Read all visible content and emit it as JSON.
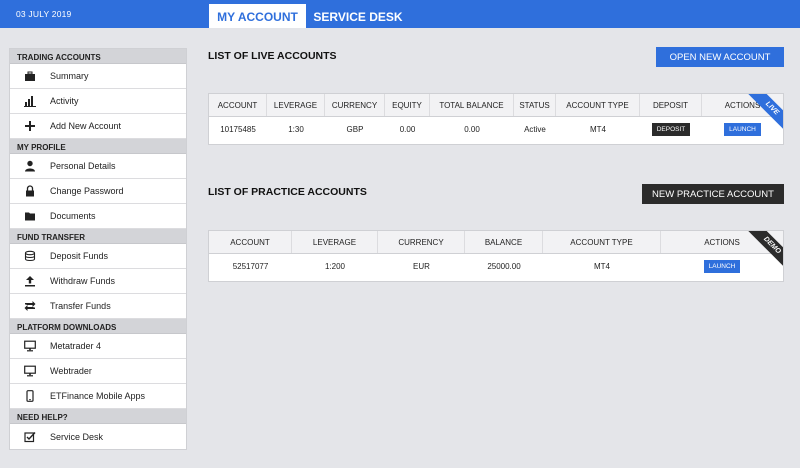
{
  "header": {
    "date": "03 JULY 2019",
    "tabs": [
      {
        "label": "MY ACCOUNT",
        "active": true
      },
      {
        "label": "SERVICE DESK",
        "active": false
      }
    ]
  },
  "sidebar": {
    "sections": [
      {
        "title": "TRADING ACCOUNTS",
        "items": [
          {
            "label": "Summary",
            "icon": "briefcase-icon"
          },
          {
            "label": "Activity",
            "icon": "bar-chart-icon"
          },
          {
            "label": "Add New Account",
            "icon": "plus-icon"
          }
        ]
      },
      {
        "title": "MY PROFILE",
        "items": [
          {
            "label": "Personal Details",
            "icon": "user-icon"
          },
          {
            "label": "Change Password",
            "icon": "lock-icon"
          },
          {
            "label": "Documents",
            "icon": "folder-icon"
          }
        ]
      },
      {
        "title": "FUND TRANSFER",
        "items": [
          {
            "label": "Deposit Funds",
            "icon": "deposit-icon"
          },
          {
            "label": "Withdraw Funds",
            "icon": "upload-icon"
          },
          {
            "label": "Transfer Funds",
            "icon": "transfer-icon"
          }
        ]
      },
      {
        "title": "PLATFORM DOWNLOADS",
        "items": [
          {
            "label": "Metatrader 4",
            "icon": "monitor-icon"
          },
          {
            "label": "Webtrader",
            "icon": "monitor-icon"
          },
          {
            "label": "ETFinance Mobile Apps",
            "icon": "mobile-icon"
          }
        ]
      },
      {
        "title": "NEED HELP?",
        "items": [
          {
            "label": "Service Desk",
            "icon": "checkbox-icon"
          }
        ]
      }
    ]
  },
  "live": {
    "title": "LIST OF LIVE ACCOUNTS",
    "button": "OPEN NEW ACCOUNT",
    "ribbon": "LIVE",
    "columns": [
      "ACCOUNT",
      "LEVERAGE",
      "CURRENCY",
      "EQUITY",
      "TOTAL BALANCE",
      "STATUS",
      "ACCOUNT TYPE",
      "DEPOSIT",
      "ACTIONS"
    ],
    "rows": [
      {
        "account": "10175485",
        "leverage": "1:30",
        "currency": "GBP",
        "equity": "0.00",
        "total_balance": "0.00",
        "status": "Active",
        "account_type": "MT4",
        "deposit": "DEPOSIT",
        "action": "LAUNCH"
      }
    ]
  },
  "practice": {
    "title": "LIST OF PRACTICE ACCOUNTS",
    "button": "NEW PRACTICE ACCOUNT",
    "ribbon": "DEMO",
    "columns": [
      "ACCOUNT",
      "LEVERAGE",
      "CURRENCY",
      "BALANCE",
      "ACCOUNT TYPE",
      "ACTIONS"
    ],
    "rows": [
      {
        "account": "52517077",
        "leverage": "1:200",
        "currency": "EUR",
        "balance": "25000.00",
        "account_type": "MT4",
        "action": "LAUNCH"
      }
    ]
  },
  "colors": {
    "accent": "#2f6fdc",
    "dark": "#2b2b2b",
    "background": "#e4e5e9"
  }
}
